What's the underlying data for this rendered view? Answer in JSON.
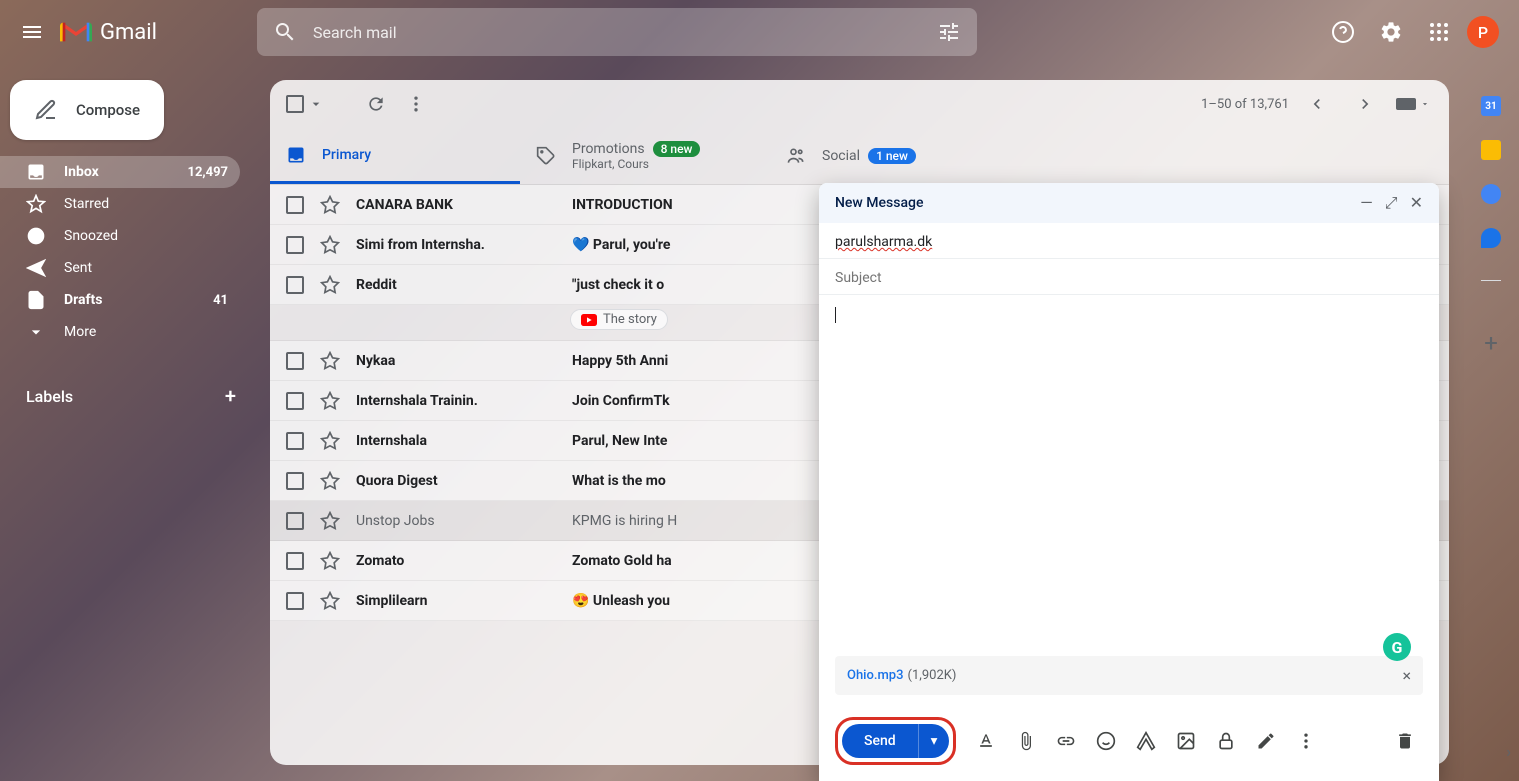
{
  "header": {
    "app_name": "Gmail",
    "search_placeholder": "Search mail",
    "avatar_letter": "P"
  },
  "compose": {
    "button_label": "Compose"
  },
  "sidebar": {
    "items": [
      {
        "label": "Inbox",
        "count": "12,497",
        "icon": "inbox"
      },
      {
        "label": "Starred",
        "count": "",
        "icon": "star"
      },
      {
        "label": "Snoozed",
        "count": "",
        "icon": "clock"
      },
      {
        "label": "Sent",
        "count": "",
        "icon": "send"
      },
      {
        "label": "Drafts",
        "count": "41",
        "icon": "draft"
      },
      {
        "label": "More",
        "count": "",
        "icon": "expand"
      }
    ],
    "labels_header": "Labels"
  },
  "toolbar": {
    "pagination": "1–50 of 13,761"
  },
  "tabs": [
    {
      "label": "Primary",
      "sub": "",
      "badge": ""
    },
    {
      "label": "Promotions",
      "sub": "Flipkart, Cours",
      "badge": "8 new"
    },
    {
      "label": "Social",
      "sub": "",
      "badge": "1 new"
    }
  ],
  "emails": [
    {
      "sender": "CANARA BANK",
      "subject": "INTRODUCTION",
      "unread": true
    },
    {
      "sender": "Simi from Internsha.",
      "subject": "💙 Parul, you're",
      "unread": true
    },
    {
      "sender": "Reddit",
      "subject": "\"just check it o",
      "unread": true,
      "chip": "The story"
    },
    {
      "sender": "Nykaa",
      "subject": "Happy 5th Anni",
      "unread": true
    },
    {
      "sender": "Internshala Trainin.",
      "subject": "Join ConfirmTk",
      "unread": true
    },
    {
      "sender": "Internshala",
      "subject": "Parul, New Inte",
      "unread": true
    },
    {
      "sender": "Quora Digest",
      "subject": "What is the mo",
      "unread": true
    },
    {
      "sender": "Unstop Jobs",
      "subject": "KPMG is hiring H",
      "unread": false
    },
    {
      "sender": "Zomato",
      "subject": "Zomato Gold ha",
      "unread": true
    },
    {
      "sender": "Simplilearn",
      "subject": "😍 Unleash you",
      "unread": true
    }
  ],
  "compose_window": {
    "title": "New Message",
    "to": "parulsharma.dk",
    "subject_placeholder": "Subject",
    "attachment_name": "Ohio.mp3",
    "attachment_size": "(1,902K)",
    "send_label": "Send"
  }
}
